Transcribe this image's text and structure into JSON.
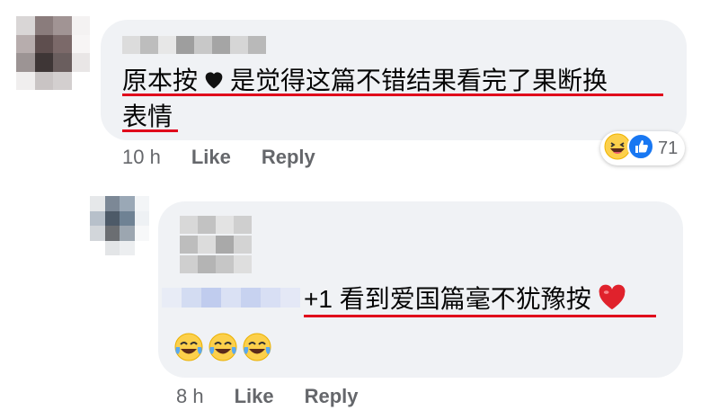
{
  "comment1": {
    "text_line1": "原本按",
    "text_line1b": "是觉得这篇不错结果看完了果断换",
    "text_line2": "表情",
    "time": "10 h",
    "like_label": "Like",
    "reply_label": "Reply",
    "reaction_count": "71"
  },
  "comment2": {
    "text": "+1 看到爱国篇毫不犹豫按",
    "time": "8 h",
    "like_label": "Like",
    "reply_label": "Reply"
  },
  "colors": {
    "bubble": "#f0f2f5",
    "underline": "#e0001b",
    "meta_text": "#65676b",
    "like_blue": "#1877f2",
    "heart_red": "#e0222c"
  }
}
